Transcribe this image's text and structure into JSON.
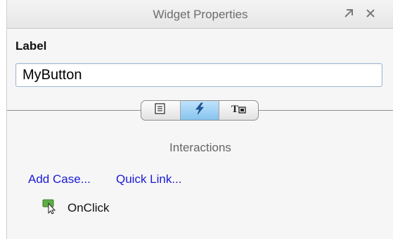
{
  "window": {
    "title": "Widget Properties"
  },
  "icons": {
    "pin": "pin-arrow-icon",
    "close": "close-icon",
    "properties": "list-page-icon",
    "interactions": "lightning-icon",
    "style": "text-style-icon",
    "event": "cursor-click-icon"
  },
  "label_field": {
    "heading": "Label",
    "value": "MyButton"
  },
  "tabs": [
    {
      "id": "properties",
      "active": false
    },
    {
      "id": "interactions",
      "active": true
    },
    {
      "id": "style",
      "active": false
    }
  ],
  "interactions": {
    "title": "Interactions",
    "add_case_label": "Add Case...",
    "quick_link_label": "Quick Link...",
    "events": [
      {
        "label": "OnClick"
      }
    ]
  },
  "colors": {
    "link": "#1a1ad6",
    "active_tab": "#9ed2f5",
    "lightning": "#1f5fa8"
  }
}
